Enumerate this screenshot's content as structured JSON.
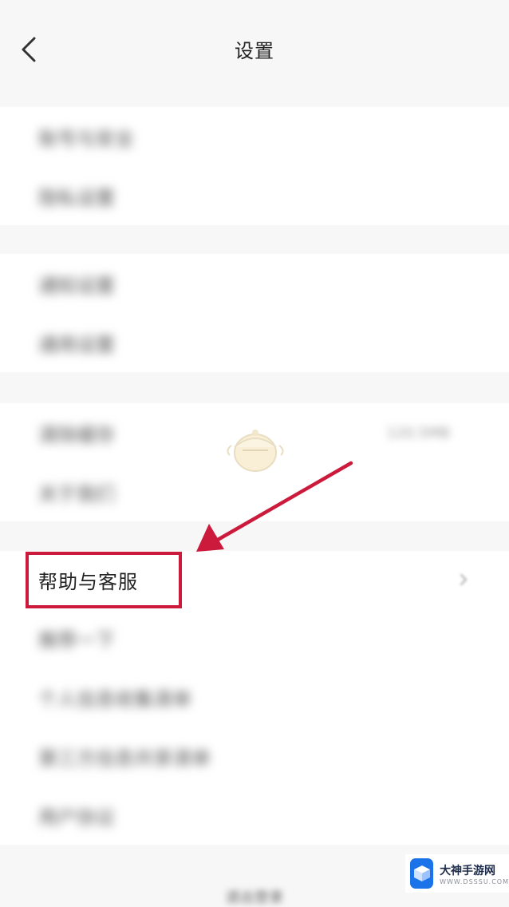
{
  "header": {
    "title": "设置"
  },
  "groups": [
    {
      "items": [
        {
          "label": "账号与安全"
        },
        {
          "label": "隐私设置"
        }
      ]
    },
    {
      "items": [
        {
          "label": "通知设置"
        },
        {
          "label": "通用设置"
        }
      ]
    },
    {
      "items": [
        {
          "label": "清除缓存",
          "value": "120.5MB"
        },
        {
          "label": "关于我们"
        }
      ]
    },
    {
      "items": [
        {
          "label": "帮助与客服"
        },
        {
          "label": "推荐一下"
        },
        {
          "label": "个人信息收集清单"
        },
        {
          "label": "第三方信息共享清单"
        },
        {
          "label": "用户协议"
        }
      ]
    }
  ],
  "bottom": {
    "label": "退出登录"
  },
  "annotation": {
    "color": "#cc1a3c"
  },
  "watermark": {
    "name": "大神手游网",
    "url": "WWW.DSSSU.COM"
  },
  "icons": [
    "back-arrow-icon",
    "chevron-right-icon",
    "mascot-icon",
    "cube-logo-icon"
  ]
}
